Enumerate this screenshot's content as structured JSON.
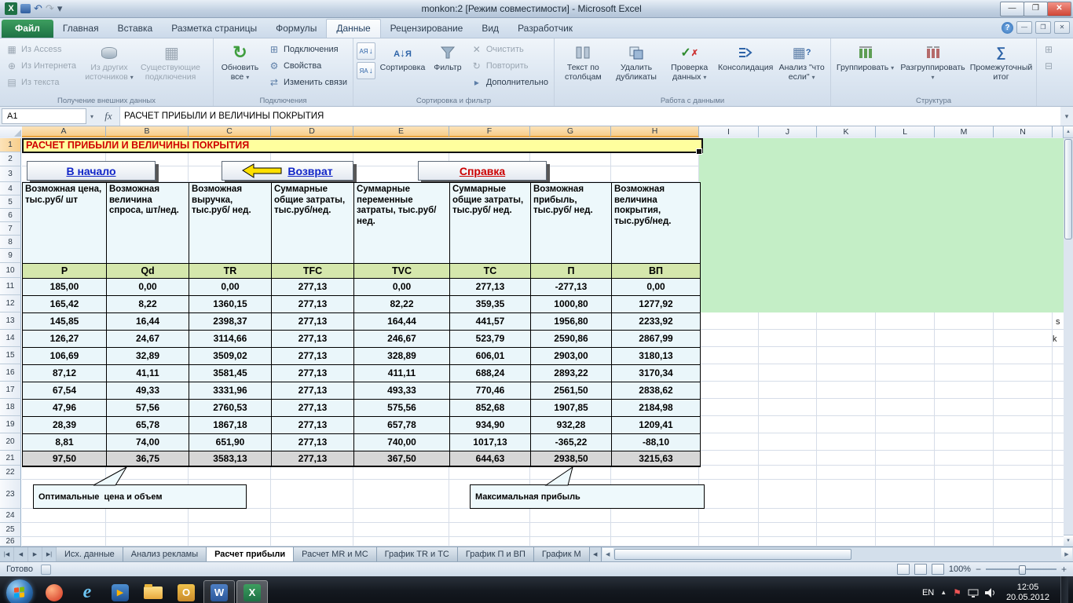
{
  "window": {
    "title": "monkon:2  [Режим совместимости]  -  Microsoft Excel"
  },
  "ribbon": {
    "file_label": "Файл",
    "tabs": [
      "Главная",
      "Вставка",
      "Разметка страницы",
      "Формулы",
      "Данные",
      "Рецензирование",
      "Вид",
      "Разработчик"
    ],
    "active_tab": "Данные",
    "groups": {
      "external": {
        "label": "Получение внешних данных",
        "small": [
          "Из Access",
          "Из Интернета",
          "Из текста"
        ],
        "big": [
          "Из других источников",
          "Существующие подключения"
        ]
      },
      "connections": {
        "label": "Подключения",
        "big_label": "Обновить все",
        "small": [
          "Подключения",
          "Свойства",
          "Изменить связи"
        ]
      },
      "sort": {
        "label": "Сортировка и фильтр",
        "az": "АЯ",
        "za": "ЯА",
        "big": [
          "Сортировка",
          "Фильтр"
        ],
        "small": [
          "Очистить",
          "Повторить",
          "Дополнительно"
        ]
      },
      "data_tools": {
        "label": "Работа с данными",
        "items": [
          "Текст по столбцам",
          "Удалить дубликаты",
          "Проверка данных",
          "Консолидация",
          "Анализ \"что если\""
        ]
      },
      "outline": {
        "label": "Структура",
        "items": [
          "Группировать",
          "Разгруппировать",
          "Промежуточный итог"
        ]
      }
    }
  },
  "formula_bar": {
    "name_box": "A1",
    "fx_label": "fx",
    "content": "РАСЧЕТ ПРИБЫЛИ И ВЕЛИЧИНЫ ПОКРЫТИЯ"
  },
  "grid": {
    "columns": [
      "A",
      "B",
      "C",
      "D",
      "E",
      "F",
      "G",
      "H",
      "I",
      "J",
      "K",
      "L",
      "M",
      "N"
    ],
    "row_count": 26,
    "selected_columns": [
      "A",
      "B",
      "C",
      "D",
      "E",
      "F",
      "G",
      "H"
    ],
    "selected_row": 1
  },
  "sheet": {
    "title_cell": "РАСЧЕТ ПРИБЫЛИ И ВЕЛИЧИНЫ ПОКРЫТИЯ",
    "nav_buttons": [
      {
        "label": "В начало"
      },
      {
        "label": "Возврат"
      },
      {
        "label": "Справка"
      }
    ],
    "table": {
      "headers": [
        "Возможная цена,  тыс.руб/ шт",
        "Возможная величина спроса, шт/нед.",
        "Возможная выручка, тыс.руб/ нед.",
        "Суммарные общие затраты, тыс.руб/нед.",
        "Суммарные переменные затраты, тыс.руб/нед.",
        "Суммарные общие затраты, тыс.руб/ нед.",
        "Возможная прибыль, тыс.руб/ нед.",
        "Возможная величина покрытия, тыс.руб/нед."
      ],
      "symbols": [
        "P",
        "Qd",
        "TR",
        "TFC",
        "TVC",
        "TC",
        "П",
        "ВП"
      ],
      "rows": [
        [
          "185,00",
          "0,00",
          "0,00",
          "277,13",
          "0,00",
          "277,13",
          "-277,13",
          "0,00"
        ],
        [
          "165,42",
          "8,22",
          "1360,15",
          "277,13",
          "82,22",
          "359,35",
          "1000,80",
          "1277,92"
        ],
        [
          "145,85",
          "16,44",
          "2398,37",
          "277,13",
          "164,44",
          "441,57",
          "1956,80",
          "2233,92"
        ],
        [
          "126,27",
          "24,67",
          "3114,66",
          "277,13",
          "246,67",
          "523,79",
          "2590,86",
          "2867,99"
        ],
        [
          "106,69",
          "32,89",
          "3509,02",
          "277,13",
          "328,89",
          "606,01",
          "2903,00",
          "3180,13"
        ],
        [
          "87,12",
          "41,11",
          "3581,45",
          "277,13",
          "411,11",
          "688,24",
          "2893,22",
          "3170,34"
        ],
        [
          "67,54",
          "49,33",
          "3331,96",
          "277,13",
          "493,33",
          "770,46",
          "2561,50",
          "2838,62"
        ],
        [
          "47,96",
          "57,56",
          "2760,53",
          "277,13",
          "575,56",
          "852,68",
          "1907,85",
          "2184,98"
        ],
        [
          "28,39",
          "65,78",
          "1867,18",
          "277,13",
          "657,78",
          "934,90",
          "932,28",
          "1209,41"
        ],
        [
          "8,81",
          "74,00",
          "651,90",
          "277,13",
          "740,00",
          "1017,13",
          "-365,22",
          "-88,10"
        ]
      ],
      "summary": [
        "97,50",
        "36,75",
        "3583,13",
        "277,13",
        "367,50",
        "644,63",
        "2938,50",
        "3215,63"
      ]
    },
    "callouts": [
      {
        "text": "Оптимальные  цена и объем"
      },
      {
        "text": "Максимальная прибыль"
      }
    ],
    "stray": [
      "s",
      "k"
    ]
  },
  "sheet_tabs": {
    "tabs": [
      "Исх. данные",
      "Анализ рекламы",
      "Расчет прибыли",
      "Расчет MR и MC",
      "График TR и TC",
      "График П и ВП",
      "График М"
    ],
    "active": "Расчет прибыли"
  },
  "status_bar": {
    "mode": "Готово",
    "zoom": "100%"
  },
  "taskbar": {
    "lang": "EN",
    "time": "12:05",
    "date": "20.05.2012"
  }
}
